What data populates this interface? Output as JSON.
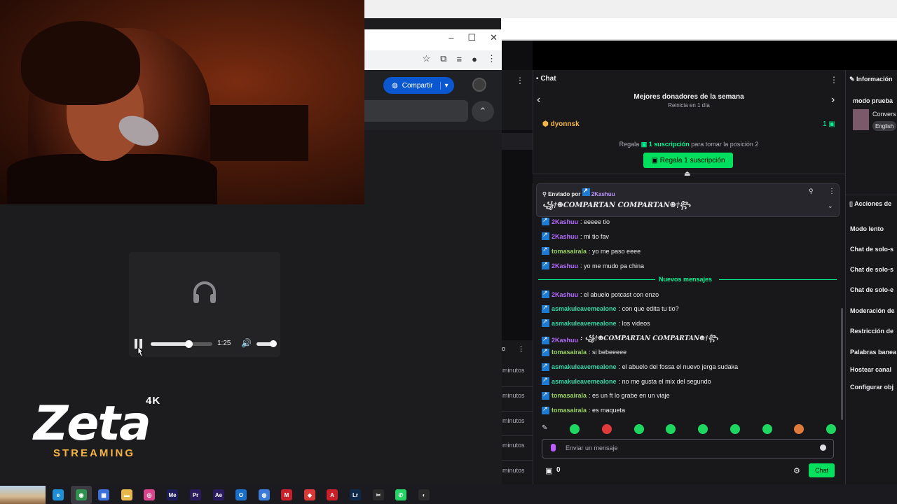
{
  "browser": {
    "controls": [
      "–",
      "☐",
      "✕"
    ]
  },
  "app": {
    "share_label": "Compartir"
  },
  "player": {
    "time": "1:25"
  },
  "logo": {
    "name": "Zeta",
    "badge": "4K",
    "tagline": "STREAMING"
  },
  "middle": {
    "minutes": [
      "minutos",
      "minutos",
      "minutos",
      "minutos",
      "minutos"
    ]
  },
  "chat": {
    "header": "Chat",
    "donors_title": "Mejores donadores de la semana",
    "donors_sub": "Reinicia en 1 día",
    "top_donor": "dyonnsk",
    "top_donor_count": "1",
    "gift_prefix": "Regala",
    "gift_amount": "1 suscripción",
    "gift_suffix": "para tomar la posición 2",
    "gift_button": "Regala 1 suscripción",
    "pinned_label": "Enviado por",
    "pinned_user": "2Kashuu",
    "pinned_message": "꧁†☻COMPARTAN COMPARTAN☻†꧂",
    "new_messages_label": "Nuevos mensajes",
    "messages_before": [
      {
        "user": "2Kashuu",
        "text": ": eeeee tio",
        "color": "purple"
      },
      {
        "user": "2Kashuu",
        "text": ": mi tio fav",
        "color": "purple"
      },
      {
        "user": "tomasairala",
        "text": ": yo me paso eeee",
        "color": "lime"
      },
      {
        "user": "2Kashuu",
        "text": ": yo me mudo pa china",
        "color": "purple"
      }
    ],
    "messages_after": [
      {
        "user": "2Kashuu",
        "text": ": el abuelo potcast con enzo",
        "color": "purple"
      },
      {
        "user": "asmakuleavemealone",
        "text": ": con que edita tu tio?",
        "color": "green"
      },
      {
        "user": "asmakuleavemealone",
        "text": ": los videos",
        "color": "green"
      },
      {
        "user": "2Kashuu",
        "text": ": ꧁†☻COMPARTAN COMPARTAN☻†꧂",
        "color": "purple"
      },
      {
        "user": "tomasairala",
        "text": ": si bebeeeee",
        "color": "lime"
      },
      {
        "user": "asmakuleavemealone",
        "text": ": el abuelo del fossa el nuevo jerga sudaka",
        "color": "green"
      },
      {
        "user": "asmakuleavemealone",
        "text": ": no me gusta el mix del segundo",
        "color": "green"
      },
      {
        "user": "tomasairala",
        "text": ": es un ft lo grabe en un viaje",
        "color": "lime"
      },
      {
        "user": "tomasairala",
        "text": ": es maqueta",
        "color": "lime"
      }
    ],
    "input_placeholder": "Enviar un mensaje",
    "gift_count": "0",
    "send_label": "Chat"
  },
  "info": {
    "title": "Información",
    "mode": "modo prueba",
    "conversation": "Convers",
    "language": "English",
    "actions_title": "Acciones de",
    "actions": [
      "Modo lento",
      "Chat de solo-s",
      "Chat de solo-s",
      "Chat de solo-e",
      "Moderación de",
      "Restricción de",
      "Palabras banea",
      "Hostear canal",
      "Configurar obj"
    ]
  },
  "taskbar": {
    "apps": [
      {
        "name": "edge-icon",
        "label": "e",
        "color": "#1f8fd8"
      },
      {
        "name": "chrome-icon",
        "label": "◉",
        "color": "#2f8f4f"
      },
      {
        "name": "store-icon",
        "label": "▦",
        "color": "#3c6fd8"
      },
      {
        "name": "explorer-icon",
        "label": "▬",
        "color": "#e8b84a"
      },
      {
        "name": "instagram-icon",
        "label": "◎",
        "color": "#d8458c"
      },
      {
        "name": "media-encoder-icon",
        "label": "Me",
        "color": "#1d1d5a"
      },
      {
        "name": "premiere-icon",
        "label": "Pr",
        "color": "#2a1a5e"
      },
      {
        "name": "after-effects-icon",
        "label": "Ae",
        "color": "#2a1a5e"
      },
      {
        "name": "outlook-icon",
        "label": "O",
        "color": "#1a6fc8"
      },
      {
        "name": "globe-icon",
        "label": "◍",
        "color": "#3a7ad8"
      },
      {
        "name": "mcafee-icon",
        "label": "M",
        "color": "#c8202a"
      },
      {
        "name": "anydesk-icon",
        "label": "◆",
        "color": "#d83a3a"
      },
      {
        "name": "acrobat-icon",
        "label": "A",
        "color": "#c8202a"
      },
      {
        "name": "lightroom-icon",
        "label": "Lr",
        "color": "#0e2a4a"
      },
      {
        "name": "capcut-icon",
        "label": "✂",
        "color": "#2a2a2a"
      },
      {
        "name": "whatsapp-icon",
        "label": "✆",
        "color": "#25d366"
      },
      {
        "name": "obs-icon",
        "label": "◐",
        "color": "#2a2a2a"
      }
    ]
  }
}
